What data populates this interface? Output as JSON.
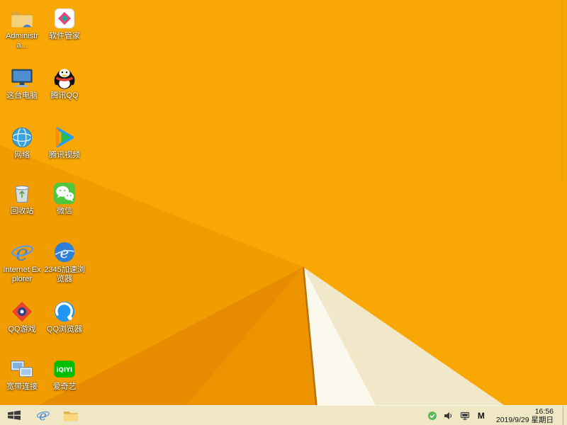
{
  "wallpaper": {
    "base_color": "#F8A705",
    "facet_left": "#F19C00",
    "facet_corner": "#E78C00",
    "facet_mid": "#ED9300",
    "facet_white": "#FBF8EE",
    "facet_cream": "#F1E7C9",
    "edge_line": "#B87300",
    "right_edge_line": "#DD9500"
  },
  "desktop": {
    "icons": [
      {
        "label": "Administra..."
      },
      {
        "label": "这台电脑"
      },
      {
        "label": "网络"
      },
      {
        "label": "回收站"
      },
      {
        "label": "Internet Explorer"
      },
      {
        "label": "QQ游戏"
      },
      {
        "label": "宽带连接"
      },
      {
        "label": "软件管家"
      },
      {
        "label": "腾讯QQ"
      },
      {
        "label": "腾讯视频"
      },
      {
        "label": "微信"
      },
      {
        "label": "2345加速浏览器"
      },
      {
        "label": "QQ浏览器"
      },
      {
        "label": "爱奇艺"
      }
    ]
  },
  "taskbar": {
    "tray": {
      "input_indicator": "M",
      "time": "16:56",
      "date": "2019/9/29 星期日"
    }
  }
}
